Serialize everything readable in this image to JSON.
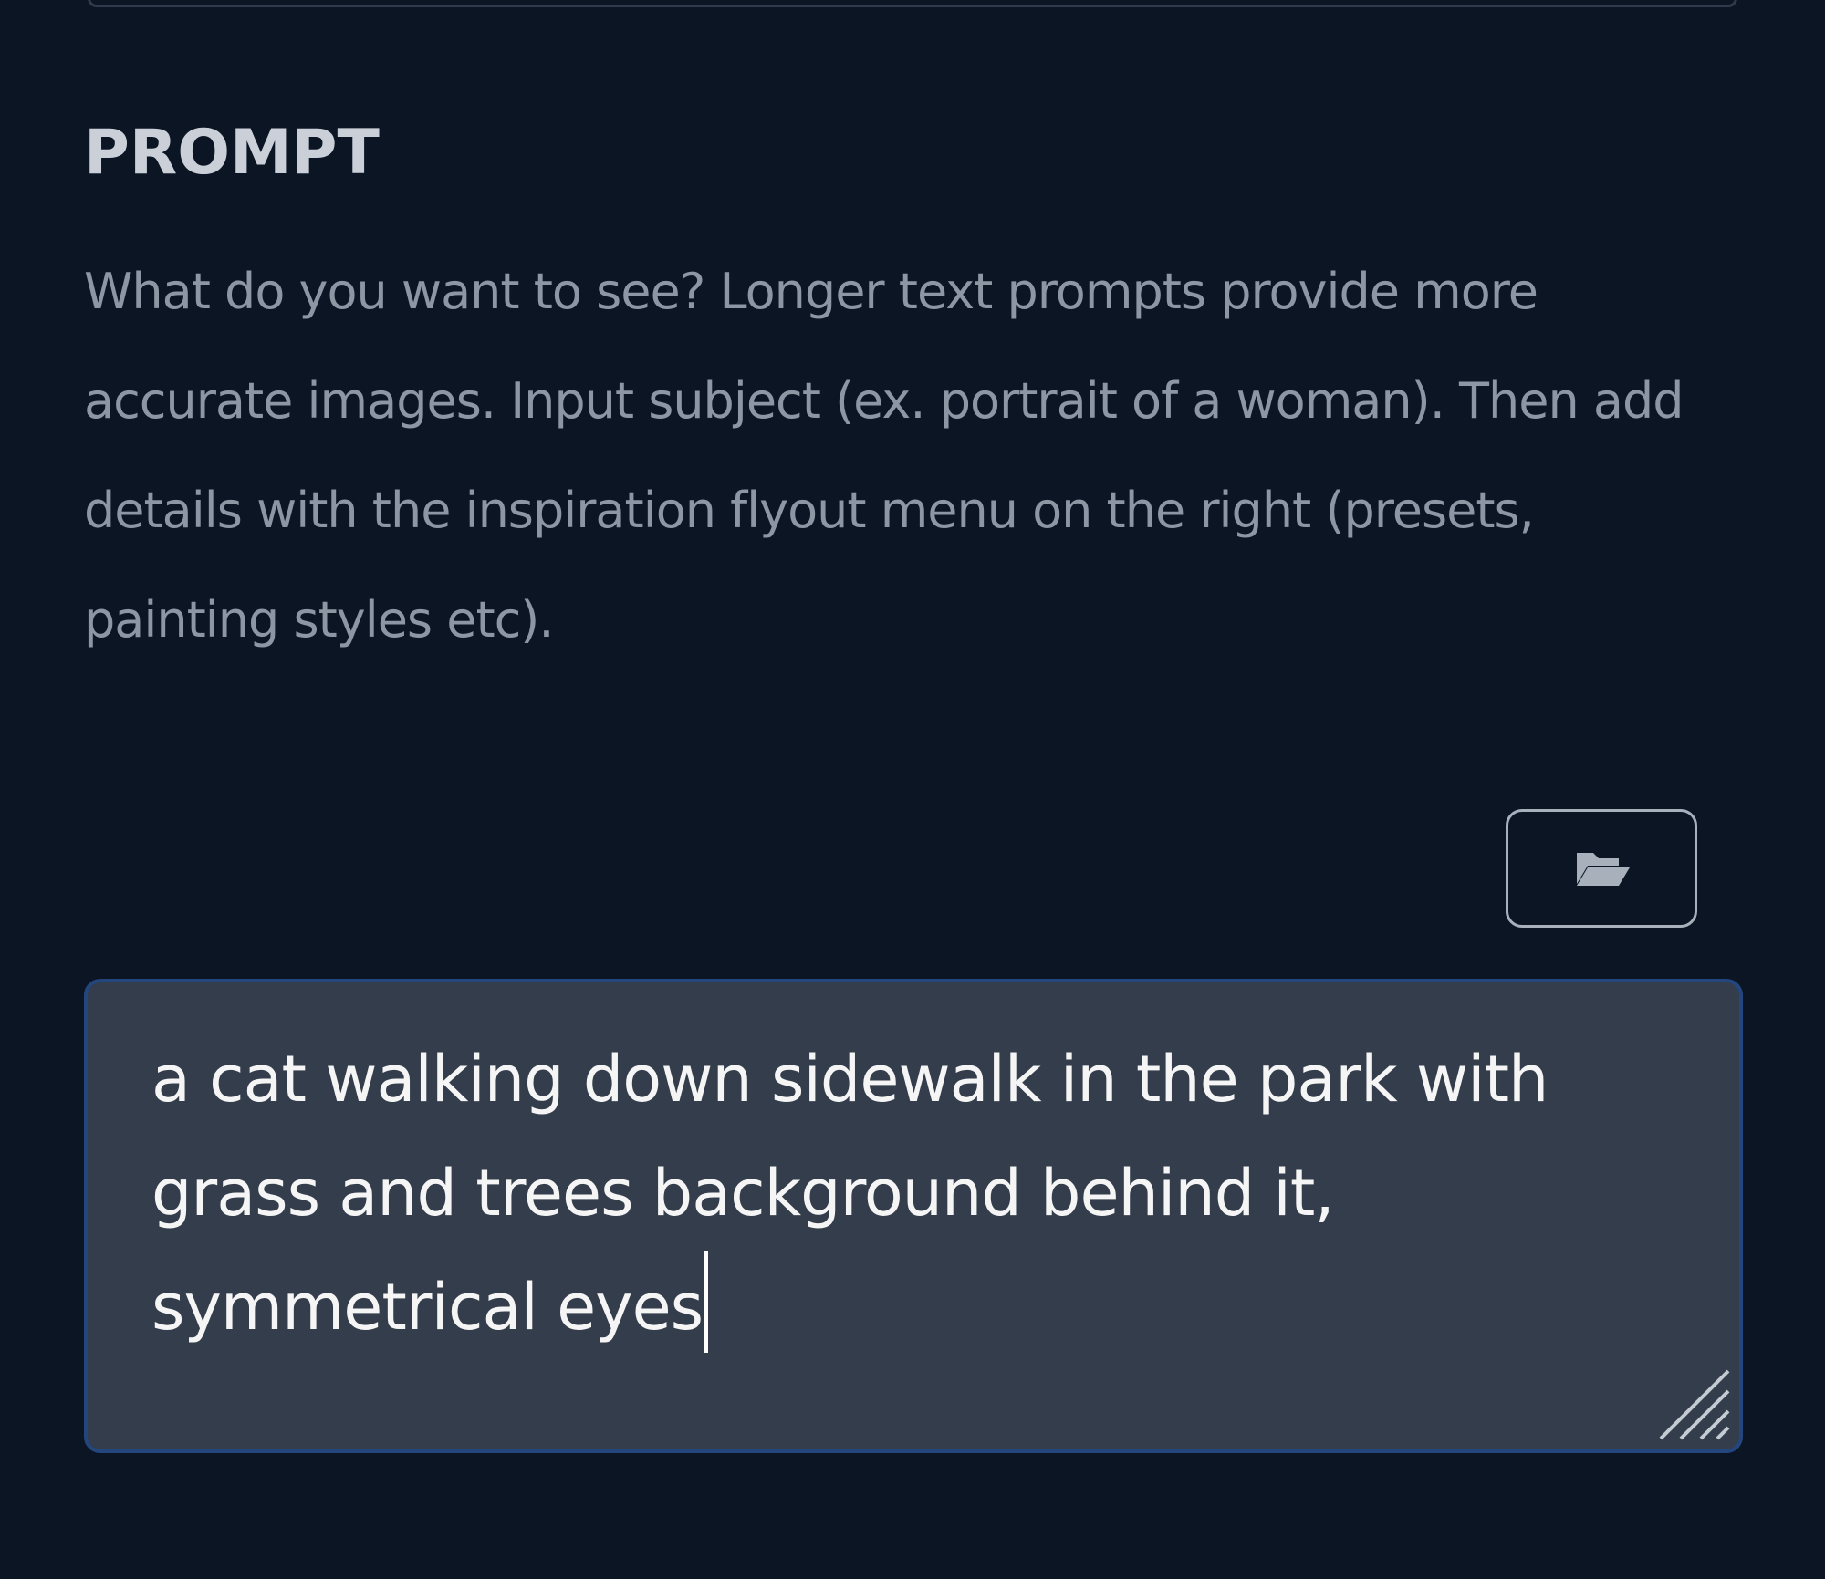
{
  "prompt_section": {
    "heading": "PROMPT",
    "description": "What do you want to see? Longer text prompts provide more accurate images. Input subject (ex. portrait of a woman). Then add details with the inspiration flyout menu on the right (presets, painting styles etc).",
    "open_file_icon": "folder-open-icon",
    "prompt_value": "a cat walking down sidewalk in the park with grass and trees background behind it, symmetrical eyes",
    "resize_icon": "resize-grip-icon"
  },
  "colors": {
    "background": "#0b1524",
    "heading_text": "#cbd0d8",
    "description_text": "#8d96a3",
    "input_background": "#333d4b",
    "input_border_focus": "#23467f",
    "input_text": "#f5f5f5",
    "button_border": "#a8b0bc"
  }
}
